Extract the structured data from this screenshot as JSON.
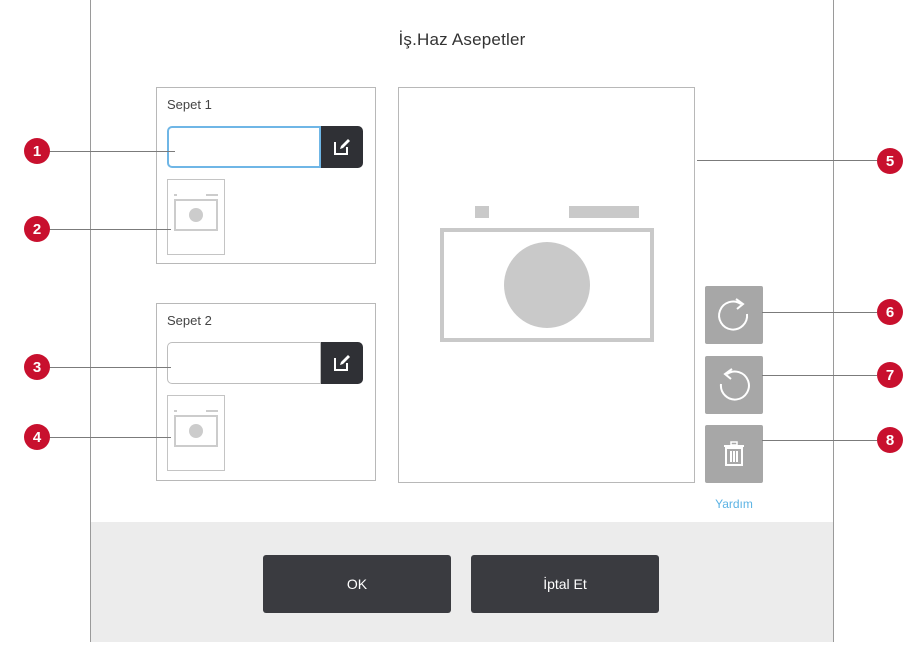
{
  "dialog": {
    "title": "İş.Haz Asepetler"
  },
  "baskets": [
    {
      "label": "Sepet 1",
      "value": ""
    },
    {
      "label": "Sepet 2",
      "value": ""
    }
  ],
  "actions": {
    "help_label": "Yardım",
    "ok_label": "OK",
    "cancel_label": "İptal Et"
  },
  "callouts": [
    "1",
    "2",
    "3",
    "4",
    "5",
    "6",
    "7",
    "8"
  ],
  "icons": {
    "edit": "pencil-square-icon",
    "rotate_clockwise": "rotate-clockwise-icon",
    "rotate_counterclockwise": "rotate-counterclockwise-icon",
    "delete": "trash-icon"
  },
  "colors": {
    "callout": "#c8102e",
    "dark_button": "#3a3b40",
    "side_button": "#a7a7a7",
    "input_focus": "#6fb6e6",
    "help_link": "#5cb3e4"
  }
}
